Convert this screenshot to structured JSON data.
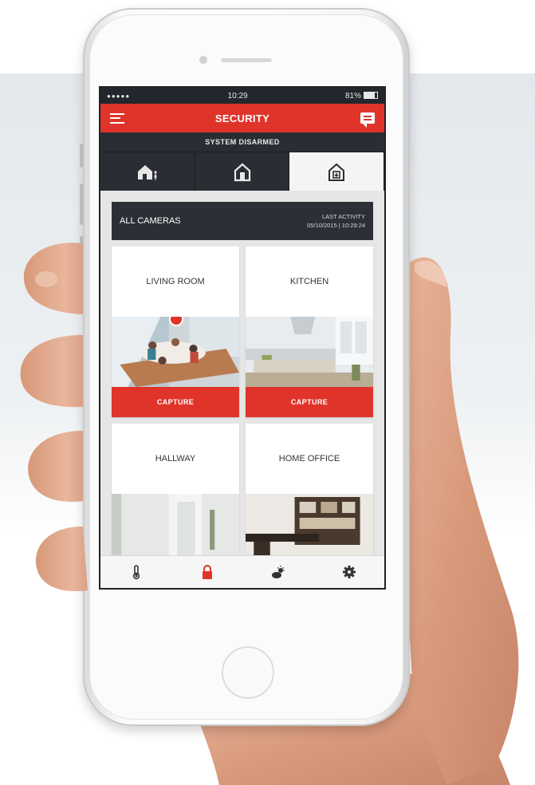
{
  "status_bar": {
    "signal": "●●●●● ",
    "time": "10:29",
    "battery": "81%"
  },
  "header": {
    "title": "SECURITY"
  },
  "system_status": "SYSTEM DISARMED",
  "modes": [
    {
      "name": "home-mode",
      "active": false
    },
    {
      "name": "away-mode",
      "active": false
    },
    {
      "name": "disarm-mode",
      "active": true
    }
  ],
  "cameras_bar": {
    "label": "ALL CAMERAS",
    "activity_label": "LAST ACTIVITY",
    "activity_time": "05/10/2015 | 10:29:24"
  },
  "cameras": [
    {
      "name": "LIVING ROOM",
      "action": "CAPTURE",
      "alert": true
    },
    {
      "name": "KITCHEN",
      "action": "CAPTURE",
      "alert": false
    },
    {
      "name": "HALLWAY",
      "action": "",
      "alert": false
    },
    {
      "name": "HOME OFFICE",
      "action": "",
      "alert": false
    }
  ],
  "tabs": [
    "thermostat-icon",
    "lock-icon",
    "weather-icon",
    "settings-icon"
  ],
  "colors": {
    "accent": "#e0342b",
    "dark": "#2a2d33",
    "surface": "#e6e6e6"
  }
}
